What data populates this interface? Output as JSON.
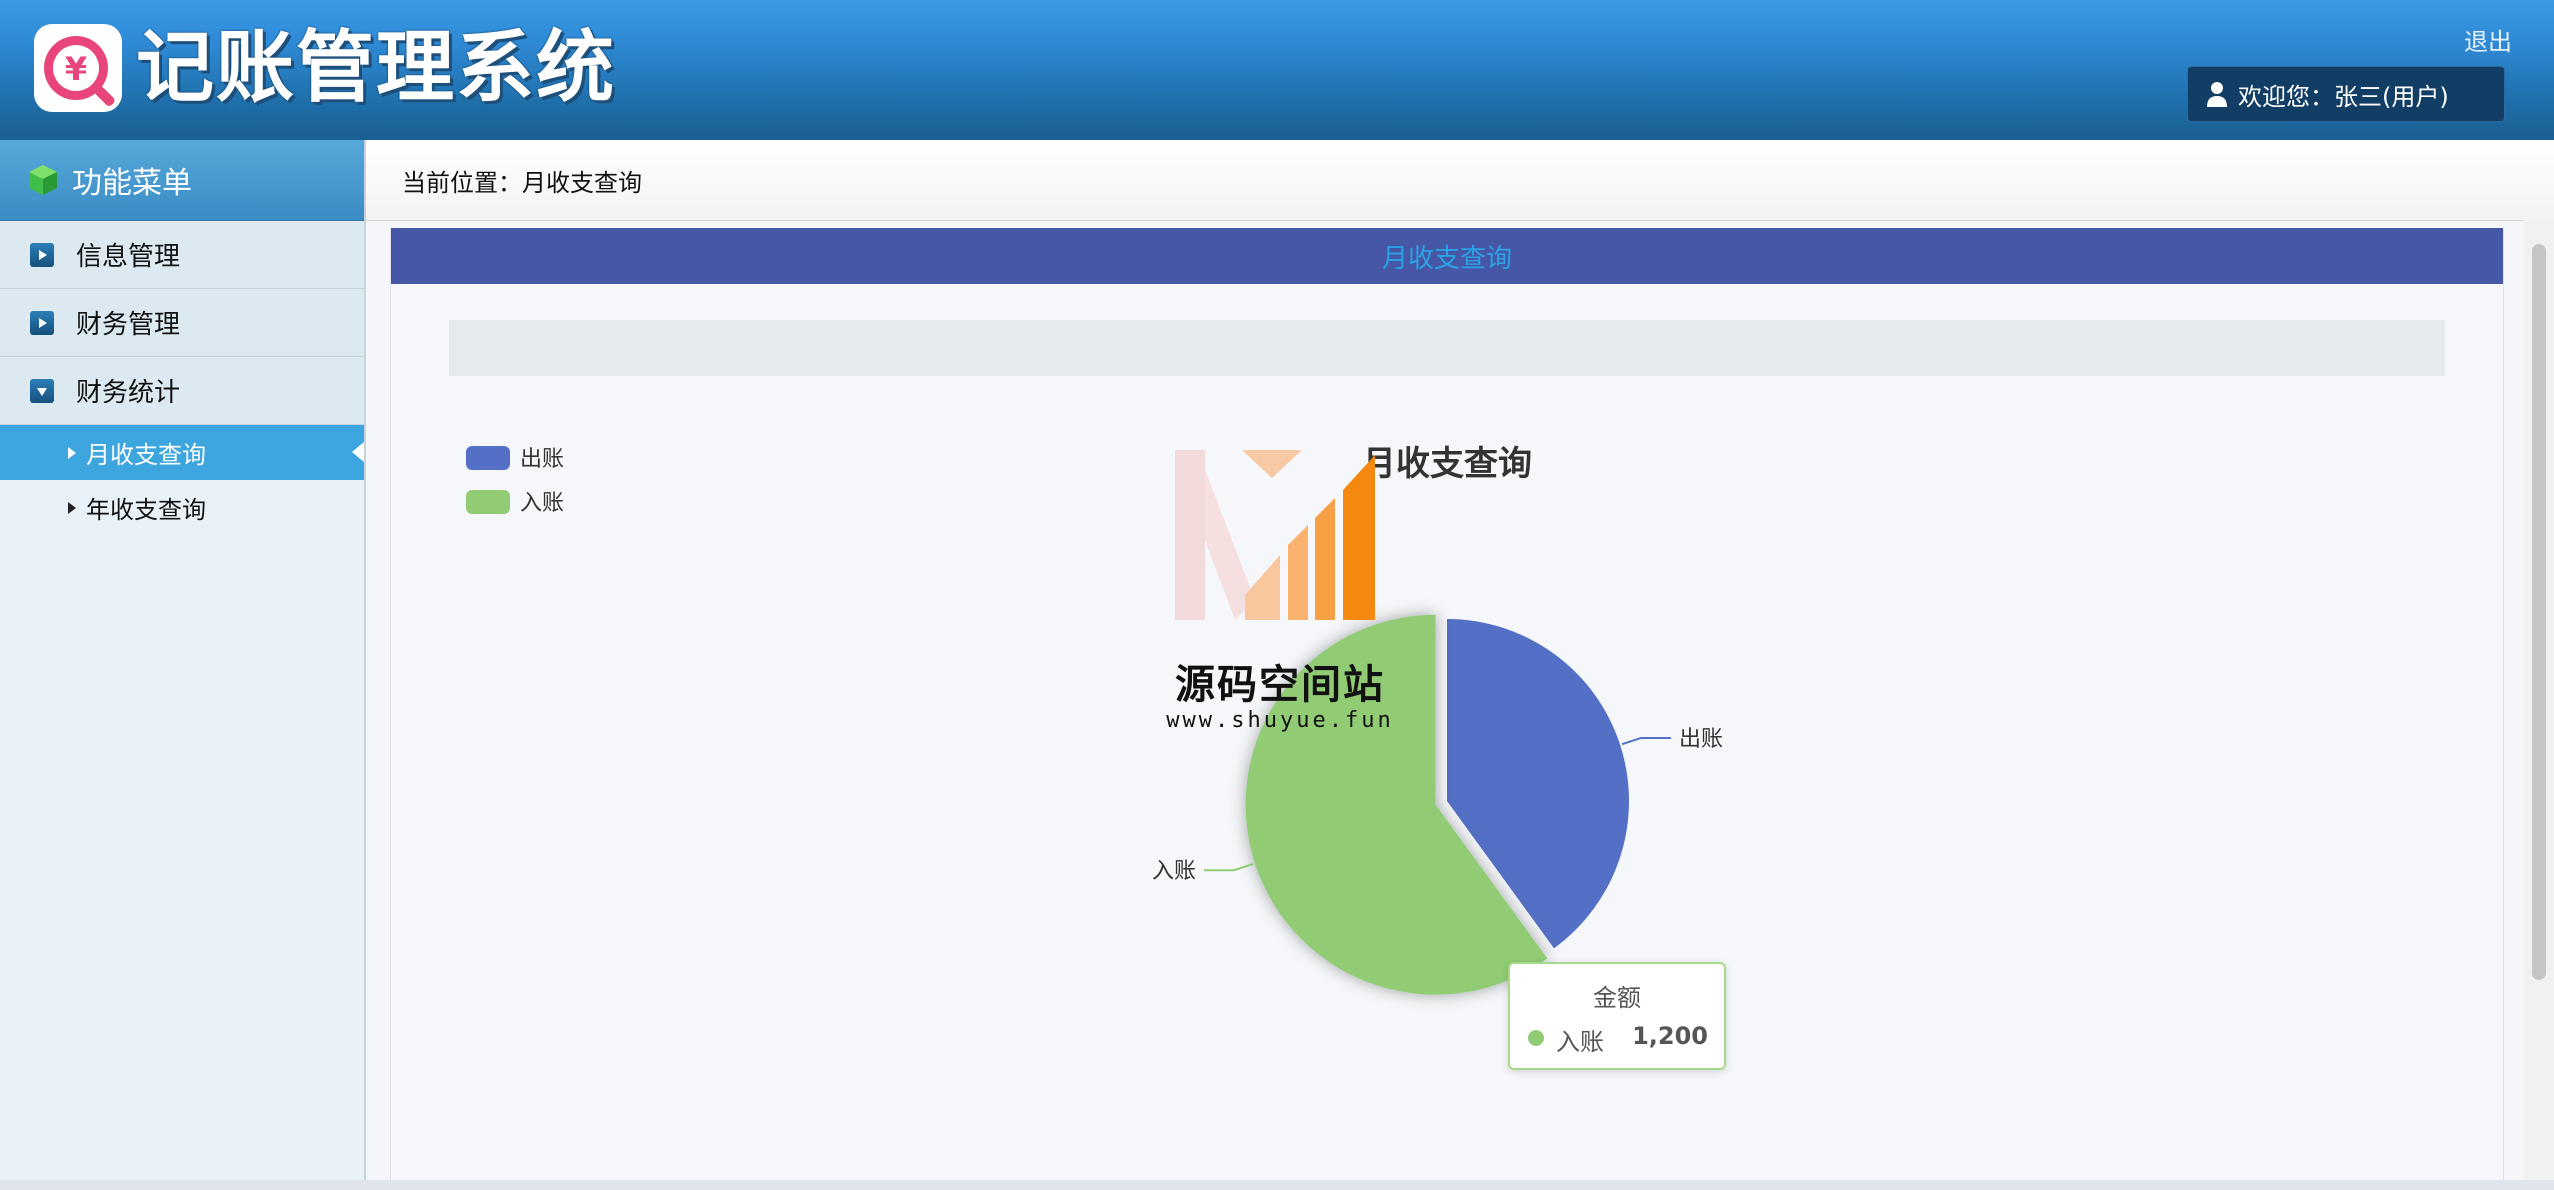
{
  "app": {
    "title": "记账管理系统",
    "logout_label": "退出",
    "welcome_text": "欢迎您：张三(用户)"
  },
  "sidebar": {
    "heading": "功能菜单",
    "groups": [
      {
        "label": "信息管理",
        "expanded": false
      },
      {
        "label": "财务管理",
        "expanded": false
      },
      {
        "label": "财务统计",
        "expanded": true
      }
    ],
    "subitems": [
      {
        "label": "月收支查询",
        "active": true
      },
      {
        "label": "年收支查询",
        "active": false
      }
    ]
  },
  "breadcrumb": "当前位置：月收支查询",
  "panel": {
    "heading": "月收支查询"
  },
  "watermark": {
    "name": "源码空间站",
    "url": "www.shuyue.fun"
  },
  "chart_data": {
    "type": "pie",
    "title": "月收支查询",
    "legend": {
      "position": "top-left",
      "entries": [
        "出账",
        "入账"
      ]
    },
    "series": [
      {
        "name": "出账",
        "value": 800,
        "color": "#5470c6"
      },
      {
        "name": "入账",
        "value": 1200,
        "color": "#91cc75"
      }
    ],
    "highlighted": "入账"
  },
  "tooltip": {
    "title": "金额",
    "name": "入账",
    "value": "1,200"
  },
  "colors": {
    "header": "#2f8ad6",
    "panel_head": "#4657a6",
    "active_menu": "#3ea6df"
  }
}
